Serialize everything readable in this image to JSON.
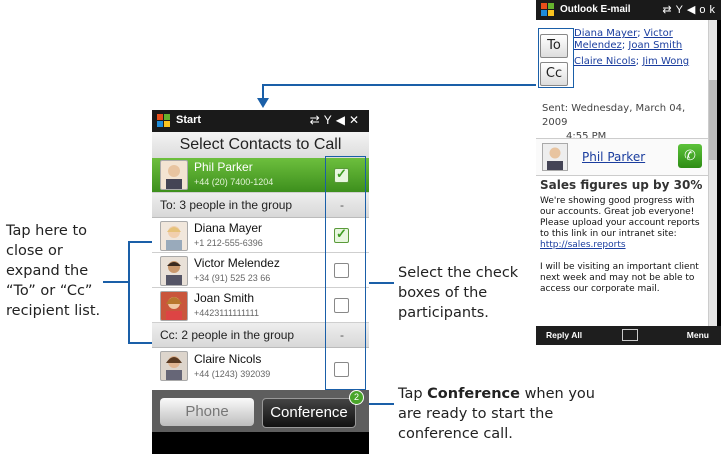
{
  "main_phone": {
    "status_title": "Start",
    "header": "Select Contacts to Call",
    "selected_contact": {
      "name": "Phil Parker",
      "phone": "+44 (20) 7400-1204"
    },
    "to_group_label": "To: 3 people in the group",
    "to_contacts": [
      {
        "name": "Diana Mayer",
        "phone": "+1 212-555-6396",
        "checked": true
      },
      {
        "name": "Victor Melendez",
        "phone": "+34 (91) 525 23 66",
        "checked": false
      },
      {
        "name": "Joan Smith",
        "phone": "+4423111111111",
        "checked": false
      }
    ],
    "cc_group_label": "Cc: 2 people in the group",
    "cc_contacts": [
      {
        "name": "Claire Nicols",
        "phone": "+44 (1243) 392039",
        "checked": false
      }
    ],
    "collapse_symbol": "-",
    "phone_button": "Phone",
    "conference_button": "Conference",
    "conference_badge": "2"
  },
  "email_phone": {
    "status_title": "Outlook E-mail",
    "status_ok": "ok",
    "to_button": "To",
    "cc_button": "Cc",
    "to_names": [
      "Diana Mayer",
      "Victor Melendez",
      "Joan Smith"
    ],
    "cc_names": [
      "Claire Nicols",
      "Jim Wong"
    ],
    "sent_label": "Sent: Wednesday, March 04, 2009",
    "sent_time": "4:55 PM",
    "sender_name": "Phil Parker",
    "subject": "Sales figures up by 30%",
    "body_1": "We're showing good progress with our accounts. Great job everyone! Please upload your account reports to this link in our intranet site:",
    "body_link": "http://sales.reports",
    "body_2": "I will be visiting an important client next week and may not be able to access our corporate mail.",
    "reply_all": "Reply All",
    "menu": "Menu"
  },
  "callouts": {
    "left": "Tap here to close or expand the “To” or “Cc” recipient list.",
    "right": "Select the check boxes of the participants.",
    "bottom_prefix": "Tap ",
    "bottom_bold": "Conference",
    "bottom_suffix": " when you are ready to start the conference call."
  },
  "colors": {
    "callout_line": "#1a5fa8",
    "selected_row": "#4ea52a",
    "link": "#1a3d9e"
  }
}
